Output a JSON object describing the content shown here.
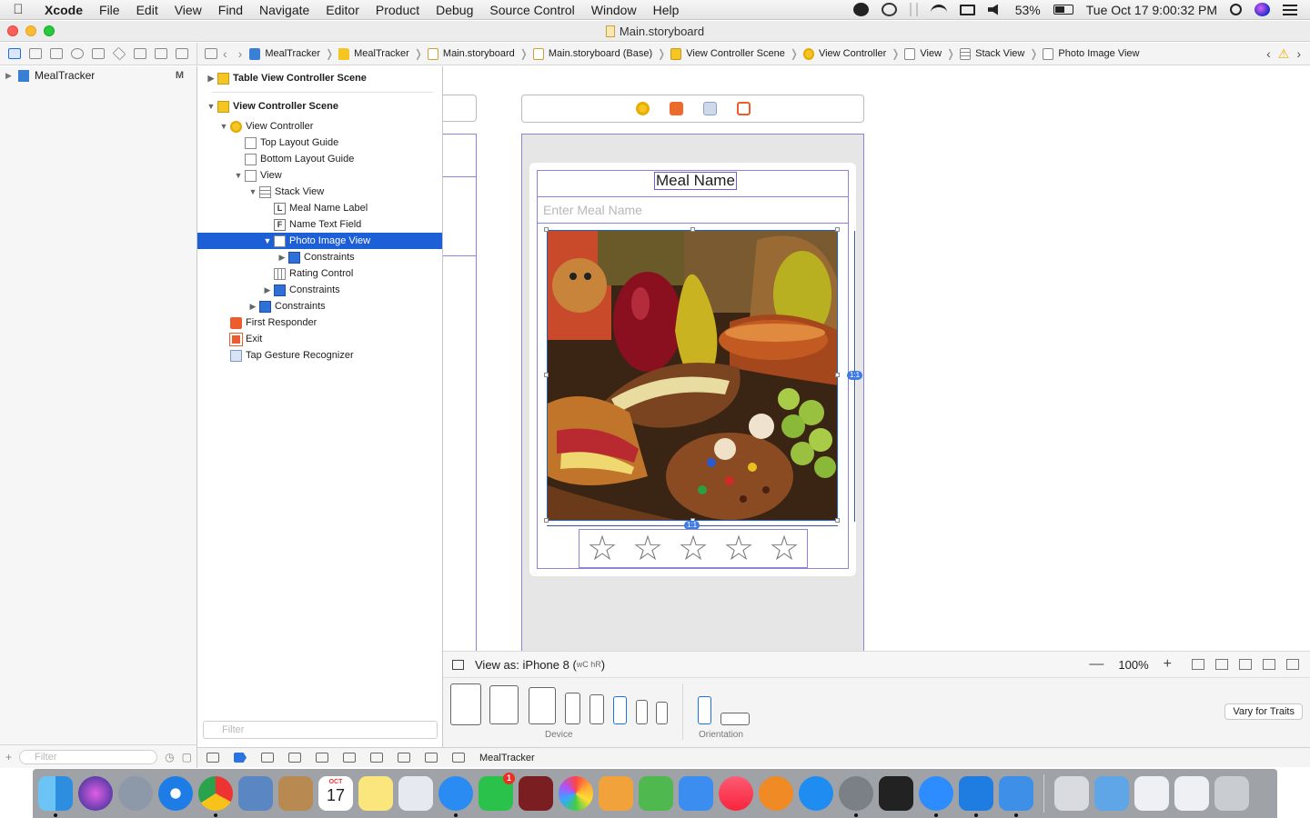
{
  "menubar": {
    "app_name": "Xcode",
    "items": [
      "File",
      "Edit",
      "View",
      "Find",
      "Navigate",
      "Editor",
      "Product",
      "Debug",
      "Source Control",
      "Window",
      "Help"
    ],
    "battery": "53%",
    "clock": "Tue Oct 17  9:00:32 PM"
  },
  "window": {
    "title": "Main.storyboard"
  },
  "jumpbar": {
    "crumbs": [
      "MealTracker",
      "MealTracker",
      "Main.storyboard",
      "Main.storyboard (Base)",
      "View Controller Scene",
      "View Controller",
      "View",
      "Stack View",
      "Photo Image View"
    ]
  },
  "project_navigator": {
    "root": {
      "label": "MealTracker",
      "badge": "M"
    },
    "filter_placeholder": "Filter"
  },
  "outline": {
    "rows": [
      {
        "label": "Table View Controller Scene"
      },
      {
        "label": "View Controller Scene"
      },
      {
        "label": "View Controller"
      },
      {
        "label": "Top Layout Guide"
      },
      {
        "label": "Bottom Layout Guide"
      },
      {
        "label": "View"
      },
      {
        "label": "Stack View"
      },
      {
        "label": "Meal Name Label",
        "glyph": "L"
      },
      {
        "label": "Name Text Field",
        "glyph": "F"
      },
      {
        "label": "Photo Image View"
      },
      {
        "label": "Constraints"
      },
      {
        "label": "Rating Control"
      },
      {
        "label": "Constraints"
      },
      {
        "label": "Constraints"
      },
      {
        "label": "First Responder"
      },
      {
        "label": "Exit"
      },
      {
        "label": "Tap Gesture Recognizer"
      }
    ],
    "filter_placeholder": "Filter"
  },
  "canvas": {
    "meal_label": "Meal Name",
    "name_field_placeholder": "Enter Meal Name",
    "aspect_badge": "1:1",
    "rating": {
      "stars": 5,
      "filled": 0,
      "star_glyph": "☆"
    }
  },
  "viewas": {
    "label": "View as: iPhone 8 (",
    "traits": "wC hR",
    "close": ")",
    "zoom": "100%",
    "zoom_out": "—",
    "zoom_in": "+"
  },
  "devicebar": {
    "device_caption": "Device",
    "orientation_caption": "Orientation",
    "vary_button": "Vary for Traits"
  },
  "debugbar": {
    "scheme": "MealTracker"
  },
  "dock": {
    "calendar_month": "OCT",
    "calendar_day": "17",
    "facetime_badge": "1"
  },
  "colors": {
    "selection": "#1d5fd6",
    "constraint_outline": "#8f83d9",
    "accent_blue": "#1d6fe6"
  }
}
